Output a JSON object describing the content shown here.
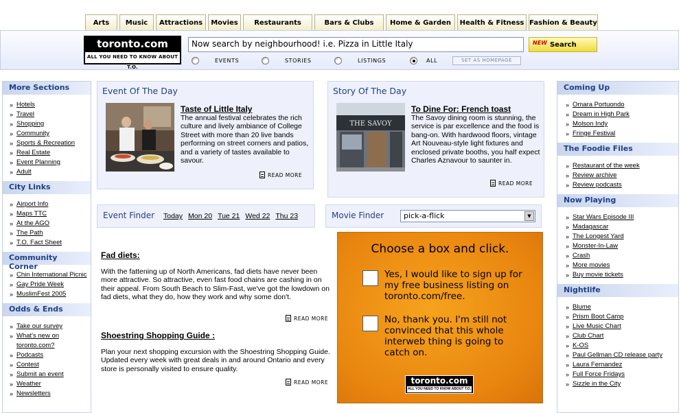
{
  "tabs": [
    "Arts",
    "Music",
    "Attractions",
    "Movies",
    "Restaurants",
    "Bars & Clubs",
    "Home & Garden",
    "Health & Fitness",
    "Fashion & Beauty"
  ],
  "logo": {
    "name": "toronto.com",
    "tagline": "ALL YOU NEED TO KNOW ABOUT T.O."
  },
  "search": {
    "value": "Now search by neighbourhood! i.e. Pizza in Little Italy",
    "button_new": "NEW",
    "button_label": "Search",
    "radios": [
      {
        "label": "EVENTS",
        "checked": false
      },
      {
        "label": "STORIES",
        "checked": false
      },
      {
        "label": "LISTINGS",
        "checked": false
      },
      {
        "label": "ALL",
        "checked": true
      }
    ],
    "homepage_label": "SET AS HOMEPAGE"
  },
  "left_sidebar": {
    "sections": [
      {
        "title": "More Sections",
        "items": [
          "Hotels",
          "Travel",
          "Shopping",
          "Community",
          "Sports & Recreation",
          "Real Estate",
          "Event Planning",
          "Adult"
        ]
      },
      {
        "title": "City Links",
        "items": [
          "Airport Info",
          "Maps TTC",
          "At the AGO",
          "The Path",
          "T.O. Fact Sheet"
        ]
      },
      {
        "title": "Community Corner",
        "items": [
          "Chin International Picnic",
          "Gay Pride Week",
          "MuslimFest 2005"
        ]
      },
      {
        "title": "Odds & Ends",
        "items": [
          "Take our survey",
          "What's new on toronto.com?",
          "Podcasts",
          "Contest",
          "Submit an event",
          "Weather",
          "Newsletters"
        ]
      }
    ]
  },
  "event_of_day": {
    "heading": "Event Of The Day",
    "title": "Taste of Little Italy",
    "body": "The annual festival celebrates the rich culture and lively ambiance of College Street with more than 20 live bands performing on street corners and patios, and a variety of tastes available to savour.",
    "more": "READ MORE"
  },
  "story_of_day": {
    "heading": "Story Of The Day",
    "title": "To Dine For: French toast",
    "body": "The Savoy dining room is stunning, the service is par excellence and the food is bang-on. With hardwood floors, vintage Art Nouveau-style light fixtures and enclosed private booths, you half expect Charles Aznavour to saunter in.",
    "more": "READ MORE"
  },
  "event_finder": {
    "heading": "Event Finder",
    "days": [
      "Today",
      "Mon 20",
      "Tue 21",
      "Wed 22",
      "Thu 23"
    ]
  },
  "movie_finder": {
    "heading": "Movie Finder",
    "selected": "pick-a-flick"
  },
  "articles": [
    {
      "title": "Fad diets:",
      "body": "With the fattening up of North Americans, fad diets have never been more attractive. So attractive, even fast food chains are cashing in on their appeal. From South Beach to Slim-Fast, we've got the lowdown on fad diets, what they do, how they work and why some don't.",
      "more": "READ MORE"
    },
    {
      "title": "Shoestring Shopping Guide :",
      "body": "Plan your next shopping excursion with the Shoestring Shopping Guide. Updated every week with great deals in and around Ontario and every store is personally visited to ensure quality.",
      "more": "READ MORE"
    }
  ],
  "ad": {
    "prompt": "Choose a box and click.",
    "option_yes": "Yes, I would like to sign up for my free business listing on toronto.com/free.",
    "option_no": "No, thank you. I'm still not convinced that this whole interweb thing is going to catch on.",
    "logo_name": "toronto.com",
    "logo_tagline": "ALL YOU NEED TO KNOW ABOUT T.O."
  },
  "right_sidebar": {
    "sections": [
      {
        "title": "Coming Up",
        "items": [
          "Omara Portuondo",
          "Dream in High Park",
          "Molson Indy",
          "Fringe Festival"
        ]
      },
      {
        "title": "The Foodie Files",
        "items": [
          "Restaurant of the week",
          "Review archive",
          "Review podcasts"
        ]
      },
      {
        "title": "Now Playing",
        "items": [
          "Star Wars Episode III",
          "Madagascar",
          "The Longest Yard",
          "Monster-In-Law",
          "Crash",
          "More movies",
          "Buy movie tickets"
        ]
      },
      {
        "title": "Nightlife",
        "items": [
          "Blume",
          "Prism Boot Camp",
          "Live Music Chart",
          "Club Chart",
          "K-OS",
          "Paul Gellman CD release party",
          "Laura Fernandez",
          "Full Force Fridays",
          "Sizzle in the City"
        ]
      }
    ]
  }
}
